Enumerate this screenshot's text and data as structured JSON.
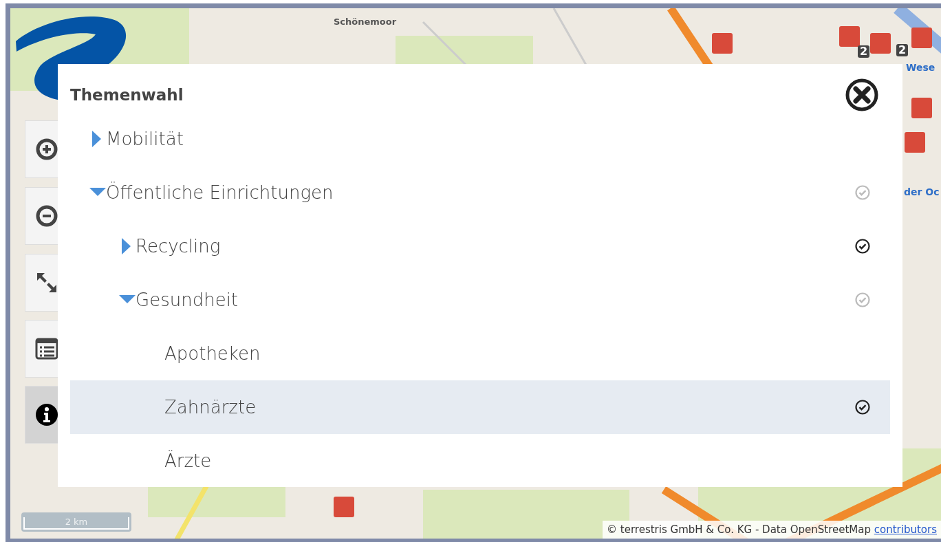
{
  "map": {
    "labels": [
      {
        "text": "Schönemoor",
        "kind": "place"
      },
      {
        "text": "Wese",
        "kind": "water"
      },
      {
        "text": "der Oc",
        "kind": "water"
      },
      {
        "text": "2",
        "kind": "count"
      },
      {
        "text": "2",
        "kind": "count"
      }
    ],
    "controls": [
      {
        "kind": "zoom-in",
        "selected": false
      },
      {
        "kind": "zoom-out",
        "selected": false
      },
      {
        "kind": "fullscreen",
        "selected": false
      },
      {
        "kind": "legend",
        "selected": false
      },
      {
        "kind": "info",
        "selected": true
      }
    ],
    "scale": "2 km",
    "attribution": {
      "text": "© terrestris GmbH & Co. KG - Data OpenStreetMap",
      "link": "contributors"
    }
  },
  "dialog": {
    "title": "Themenwahl",
    "tree": [
      {
        "label": "Mobilität",
        "expanded": false,
        "selected": false
      },
      {
        "label": "Öffentliche Einrichtungen",
        "expanded": true,
        "checked": false,
        "selected": false,
        "children": [
          {
            "label": "Recycling",
            "expanded": false,
            "checked": true,
            "selected": false
          },
          {
            "label": "Gesundheit",
            "expanded": true,
            "checked": false,
            "selected": false,
            "children": [
              {
                "label": "Apotheken",
                "selected": false
              },
              {
                "label": "Zahnärzte",
                "checked": true,
                "selected": true
              },
              {
                "label": "Ärzte",
                "selected": false
              }
            ]
          }
        ]
      }
    ]
  }
}
